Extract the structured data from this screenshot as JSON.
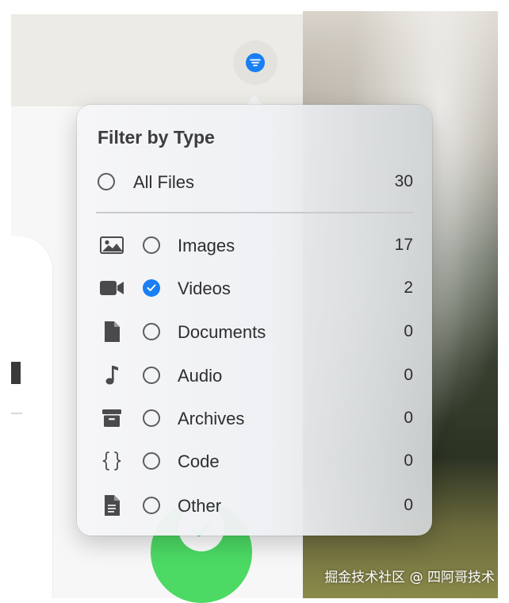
{
  "popover": {
    "title": "Filter by Type",
    "all_files": {
      "label": "All Files",
      "count": "30",
      "selected": false
    },
    "items": [
      {
        "icon": "image-icon",
        "label": "Images",
        "count": "17",
        "selected": false
      },
      {
        "icon": "video-camera-icon",
        "label": "Videos",
        "count": "2",
        "selected": true
      },
      {
        "icon": "document-icon",
        "label": "Documents",
        "count": "0",
        "selected": false
      },
      {
        "icon": "music-note-icon",
        "label": "Audio",
        "count": "0",
        "selected": false
      },
      {
        "icon": "archive-box-icon",
        "label": "Archives",
        "count": "0",
        "selected": false
      },
      {
        "icon": "code-braces-icon",
        "label": "Code",
        "count": "0",
        "selected": false
      },
      {
        "icon": "text-file-icon",
        "label": "Other",
        "count": "0",
        "selected": false
      }
    ]
  },
  "toolbar": {
    "filter_icon": "filter-lines-icon"
  },
  "confirm": {
    "icon": "checkmark-icon"
  },
  "watermark": "掘金技术社区 @ 四阿哥技术",
  "colors": {
    "accent": "#1a7ef5",
    "confirm": "#4cd964"
  }
}
